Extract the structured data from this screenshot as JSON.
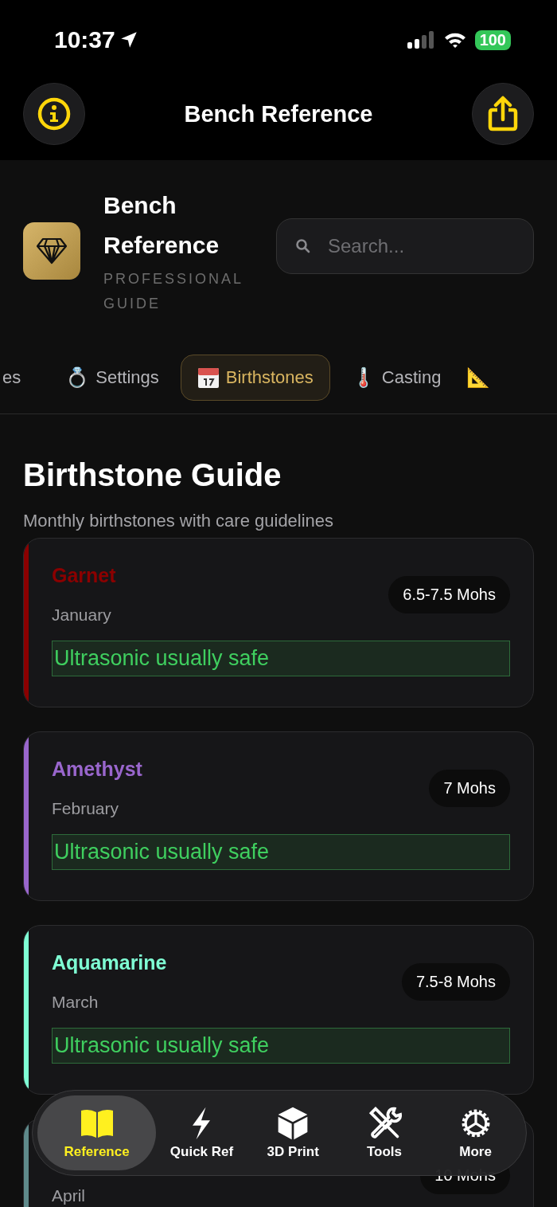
{
  "status_bar": {
    "time": "10:37",
    "battery": "100"
  },
  "nav_bar": {
    "title": "Bench Reference"
  },
  "app_header": {
    "title": "Bench Reference",
    "subtitle": "PROFESSIONAL GUIDE",
    "search": {
      "placeholder": "Search..."
    }
  },
  "tabs": [
    {
      "label": "es",
      "selected": false
    },
    {
      "icon": "💍",
      "label": "Settings",
      "selected": false
    },
    {
      "label": "Birthstones",
      "selected": true
    },
    {
      "icon": "🌡️",
      "label": "Casting",
      "selected": false
    },
    {
      "icon": "📐",
      "selected": false
    }
  ],
  "section": {
    "title": "Birthstone Guide",
    "subtitle": "Monthly birthstones with care guidelines"
  },
  "stones": [
    {
      "name": "Garnet",
      "month": "January",
      "hardness": "6.5-7.5 Mohs",
      "care": "Ultrasonic usually safe",
      "color": "#8b0000"
    },
    {
      "name": "Amethyst",
      "month": "February",
      "hardness": "7 Mohs",
      "care": "Ultrasonic usually safe",
      "color": "#9966cc"
    },
    {
      "name": "Aquamarine",
      "month": "March",
      "hardness": "7.5-8 Mohs",
      "care": "Ultrasonic usually safe",
      "color": "#7fffd4"
    },
    {
      "month": "April",
      "hardness": "10 Mohs",
      "color": "#5f8a8b"
    }
  ],
  "bottom_nav": [
    {
      "label": "Reference",
      "selected": true
    },
    {
      "label": "Quick Ref",
      "selected": false
    },
    {
      "label": "3D Print",
      "selected": false
    },
    {
      "label": "Tools",
      "selected": false
    },
    {
      "label": "More",
      "selected": false
    }
  ]
}
